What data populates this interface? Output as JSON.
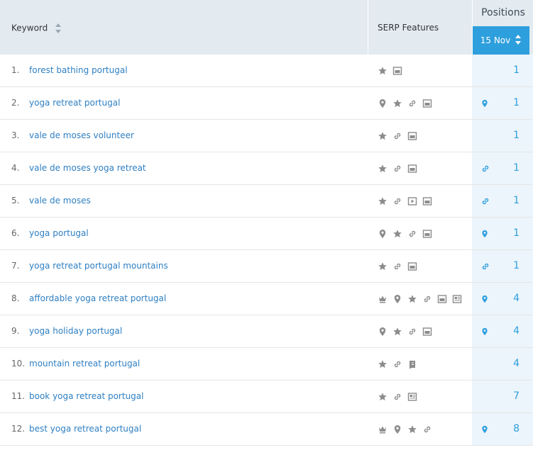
{
  "header": {
    "keyword_label": "Keyword",
    "serp_label": "SERP Features",
    "positions_label": "Positions",
    "date_label": "15 Nov"
  },
  "colors": {
    "accent": "#2e9fdd",
    "link": "#2e7fc2",
    "header_bg": "#e3ebf1",
    "pos_bg": "#ecf5fc"
  },
  "rows": [
    {
      "num": "1.",
      "keyword": "forest bathing portugal",
      "serp": [
        "star-icon",
        "image-icon"
      ],
      "pos_icon": "",
      "position": "1"
    },
    {
      "num": "2.",
      "keyword": "yoga retreat portugal",
      "serp": [
        "map-pin-icon",
        "star-icon",
        "link-icon",
        "image-icon"
      ],
      "pos_icon": "map-pin-icon",
      "position": "1"
    },
    {
      "num": "3.",
      "keyword": "vale de moses volunteer",
      "serp": [
        "star-icon",
        "link-icon",
        "image-icon"
      ],
      "pos_icon": "",
      "position": "1"
    },
    {
      "num": "4.",
      "keyword": "vale de moses yoga retreat",
      "serp": [
        "star-icon",
        "link-icon",
        "image-icon"
      ],
      "pos_icon": "link-icon",
      "position": "1"
    },
    {
      "num": "5.",
      "keyword": "vale de moses",
      "serp": [
        "star-icon",
        "link-icon",
        "video-icon",
        "image-icon"
      ],
      "pos_icon": "link-icon",
      "position": "1"
    },
    {
      "num": "6.",
      "keyword": "yoga portugal",
      "serp": [
        "map-pin-icon",
        "star-icon",
        "link-icon",
        "image-icon"
      ],
      "pos_icon": "map-pin-icon",
      "position": "1"
    },
    {
      "num": "7.",
      "keyword": "yoga retreat portugal mountains",
      "serp": [
        "star-icon",
        "link-icon",
        "image-icon"
      ],
      "pos_icon": "link-icon",
      "position": "1"
    },
    {
      "num": "8.",
      "keyword": "affordable yoga retreat portugal",
      "serp": [
        "crown-icon",
        "map-pin-icon",
        "star-icon",
        "link-icon",
        "image-icon",
        "news-icon"
      ],
      "pos_icon": "map-pin-icon",
      "position": "4"
    },
    {
      "num": "9.",
      "keyword": "yoga holiday portugal",
      "serp": [
        "map-pin-icon",
        "star-icon",
        "link-icon",
        "image-icon"
      ],
      "pos_icon": "map-pin-icon",
      "position": "4"
    },
    {
      "num": "10.",
      "keyword": "mountain retreat portugal",
      "serp": [
        "star-icon",
        "link-icon",
        "knowledge-icon"
      ],
      "pos_icon": "",
      "position": "4"
    },
    {
      "num": "11.",
      "keyword": "book yoga retreat portugal",
      "serp": [
        "star-icon",
        "link-icon",
        "news-icon"
      ],
      "pos_icon": "",
      "position": "7"
    },
    {
      "num": "12.",
      "keyword": "best yoga retreat portugal",
      "serp": [
        "crown-icon",
        "map-pin-icon",
        "star-icon",
        "link-icon"
      ],
      "pos_icon": "map-pin-icon",
      "position": "8"
    }
  ]
}
